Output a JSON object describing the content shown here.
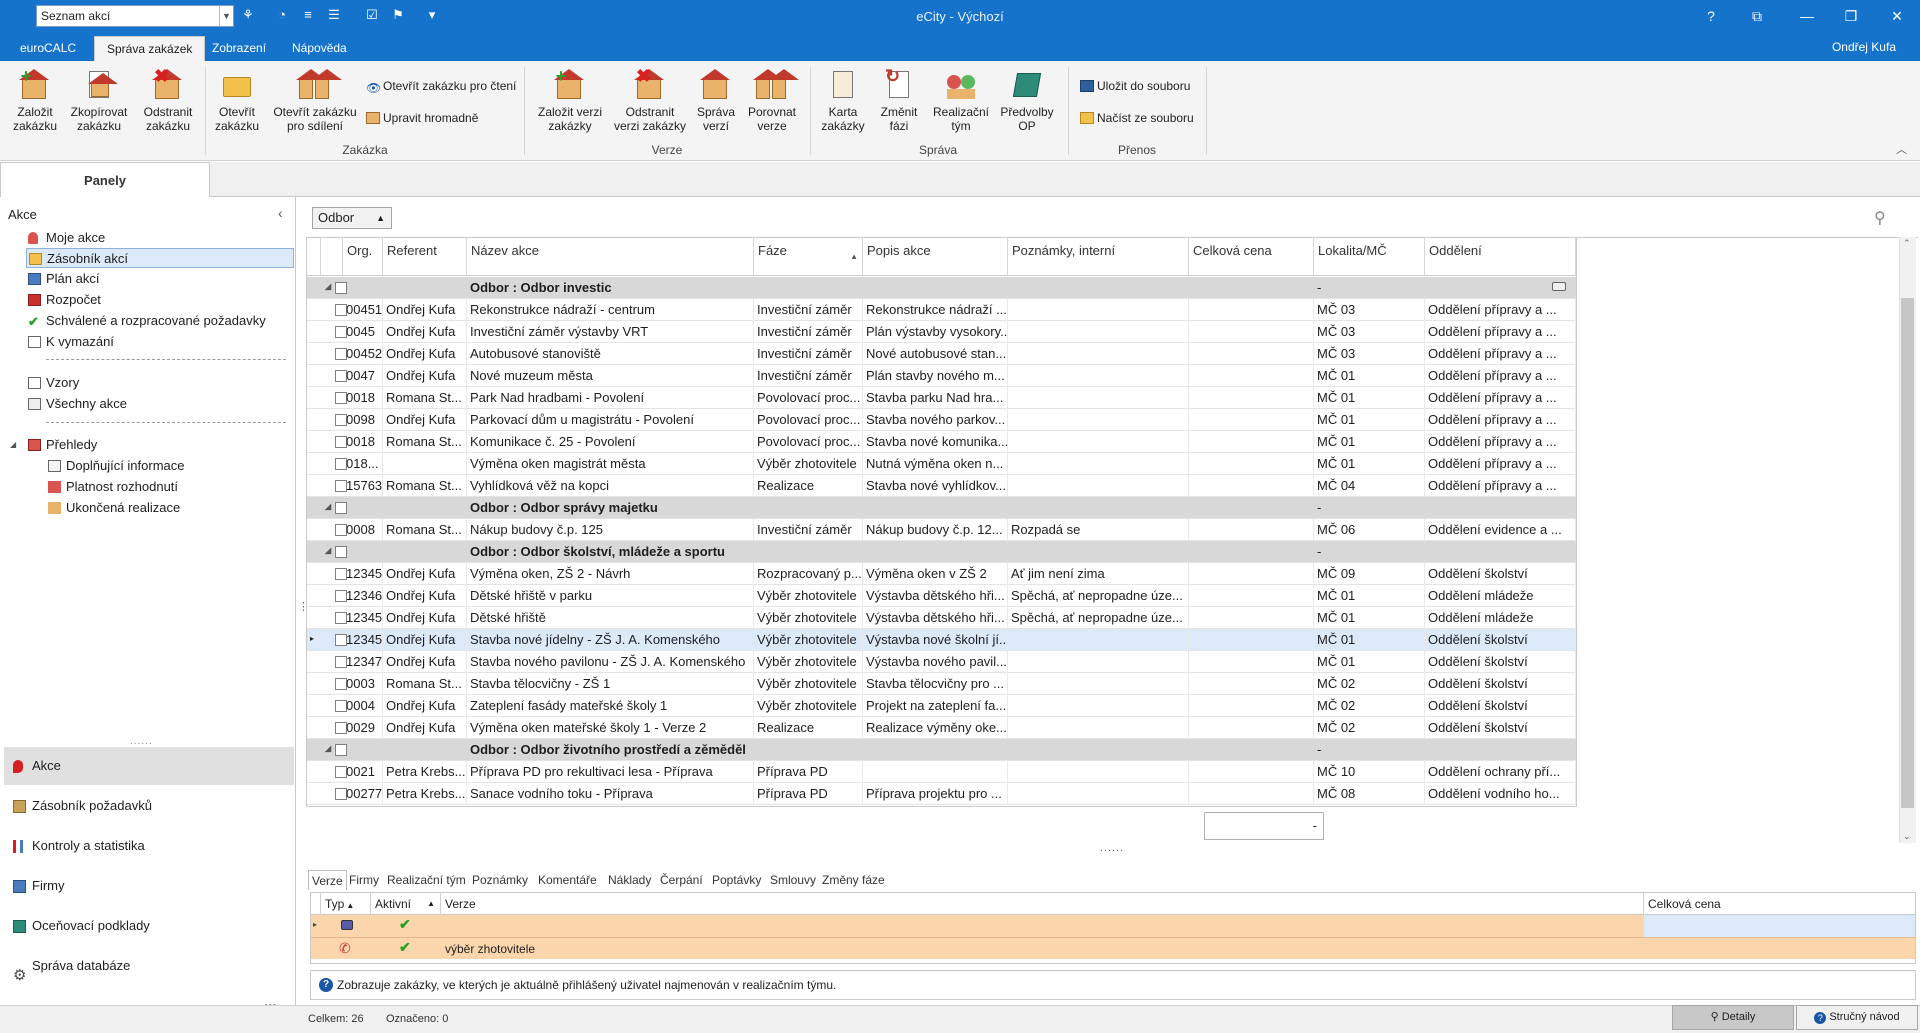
{
  "titlebar": {
    "combo_value": "Seznam akcí",
    "app_title": "eCity - Výchozí"
  },
  "menu": {
    "tabs": [
      "euroCALC",
      "Správa zakázek",
      "Zobrazení",
      "Nápověda"
    ],
    "active_tab": "Správa zakázek",
    "user": "Ondřej Kufa"
  },
  "ribbon": {
    "zakazka": {
      "group": "Zakázka",
      "zalozit": "Založit\nzakázku",
      "zkopirovat": "Zkopírovat\nzakázku",
      "odstranit": "Odstranit\nzakázku",
      "otevrit": "Otevřít\nzakázku",
      "otevrit_sdileni": "Otevřít zakázku\npro sdílení",
      "otevrit_cteni": "Otevřít zakázku pro čtení",
      "upravit_hromadne": "Upravit hromadně"
    },
    "verze": {
      "group": "Verze",
      "zalozit": "Založit verzi\nzakázky",
      "odstranit": "Odstranit\nverzi zakázky",
      "sprava": "Správa\nverzí",
      "porovnat": "Porovnat\nverze"
    },
    "sprava": {
      "group": "Správa",
      "karta": "Karta\nzakázky",
      "zmenit": "Změnit\nfázi",
      "tym": "Realizační\ntým",
      "predvolby": "Předvolby\nOP"
    },
    "prenos": {
      "group": "Přenos",
      "ulozit": "Uložit do souboru",
      "nacist": "Načíst ze souboru"
    }
  },
  "left": {
    "panel_tab": "Panely",
    "section": "Akce",
    "items": [
      {
        "label": "Moje akce",
        "icon": "person-icon"
      },
      {
        "label": "Zásobník akcí",
        "icon": "folder-icon"
      },
      {
        "label": "Plán akcí",
        "icon": "plan-icon"
      },
      {
        "label": "Rozpočet",
        "icon": "budget-icon"
      },
      {
        "label": "Schválené a rozpracované požadavky",
        "icon": "check-icon"
      },
      {
        "label": "K vymazání",
        "icon": "erase-icon"
      }
    ],
    "items2": [
      {
        "label": "Vzory",
        "icon": "template-icon"
      },
      {
        "label": "Všechny akce",
        "icon": "all-icon"
      }
    ],
    "overview": {
      "label": "Přehledy",
      "children": [
        "Doplňující informace",
        "Platnost rozhodnutí",
        "Ukončená realizace"
      ]
    },
    "nav": [
      "Akce",
      "Zásobník požadavků",
      "Kontroly a statistika",
      "Firmy",
      "Oceňovací podklady",
      "Správa databáze"
    ],
    "more": "•••"
  },
  "filter": {
    "chip": "Odbor"
  },
  "grid": {
    "columns": [
      "Org.",
      "Referent",
      "Název akce",
      "Fáze",
      "Popis akce",
      "Poznámky, interní",
      "Celková cena",
      "Lokalita/MČ",
      "Oddělení"
    ],
    "rows": [
      {
        "type": "group",
        "label": "Odbor : Odbor investic",
        "price": "-"
      },
      {
        "org": "00451",
        "ref": "Ondřej Kufa",
        "name": "Rekonstrukce nádraží - centrum",
        "faze": "Investiční záměr",
        "popis": "Rekonstrukce nádraží ...",
        "pozn": "",
        "cena": "",
        "lok": "MČ 03",
        "odd": "Oddělení přípravy a ..."
      },
      {
        "org": "0045",
        "ref": "Ondřej Kufa",
        "name": "Investiční záměr výstavby VRT",
        "faze": "Investiční záměr",
        "popis": "Plán výstavby vysokory...",
        "pozn": "",
        "cena": "",
        "lok": "MČ 03",
        "odd": "Oddělení přípravy a ..."
      },
      {
        "org": "00452",
        "ref": "Ondřej Kufa",
        "name": "Autobusové stanoviště",
        "faze": "Investiční záměr",
        "popis": "Nové autobusové stan...",
        "pozn": "",
        "cena": "",
        "lok": "MČ 03",
        "odd": "Oddělení přípravy a ..."
      },
      {
        "org": "0047",
        "ref": "Ondřej Kufa",
        "name": "Nové muzeum města",
        "faze": "Investiční záměr",
        "popis": "Plán stavby nového m...",
        "pozn": "",
        "cena": "",
        "lok": "MČ 01",
        "odd": "Oddělení přípravy a ..."
      },
      {
        "org": "0018",
        "ref": "Romana St...",
        "name": "Park Nad hradbami - Povolení",
        "faze": "Povolovací proc...",
        "popis": "Stavba parku Nad hra...",
        "pozn": "",
        "cena": "",
        "lok": "MČ 01",
        "odd": "Oddělení přípravy a ..."
      },
      {
        "org": "0098",
        "ref": "Ondřej Kufa",
        "name": "Parkovací dům u magistrátu - Povolení",
        "faze": "Povolovací proc...",
        "popis": "Stavba nového parkov...",
        "pozn": "",
        "cena": "",
        "lok": "MČ 01",
        "odd": "Oddělení přípravy a ..."
      },
      {
        "org": "0018",
        "ref": "Romana St...",
        "name": "Komunikace č. 25 - Povolení",
        "faze": "Povolovací proc...",
        "popis": "Stavba nové komunika...",
        "pozn": "",
        "cena": "",
        "lok": "MČ 01",
        "odd": "Oddělení přípravy a ..."
      },
      {
        "org": "018...",
        "ref": "",
        "name": "Výměna oken magistrát města",
        "faze": "Výběr zhotovitele",
        "popis": "Nutná výměna oken n...",
        "pozn": "",
        "cena": "",
        "lok": "MČ 01",
        "odd": "Oddělení přípravy a ..."
      },
      {
        "org": "15763",
        "ref": "Romana St...",
        "name": "Vyhlídková věž na kopci",
        "faze": "Realizace",
        "popis": "Stavba nové vyhlídkov...",
        "pozn": "",
        "cena": "",
        "lok": "MČ 04",
        "odd": "Oddělení přípravy a ..."
      },
      {
        "type": "group",
        "label": "Odbor : Odbor správy majetku",
        "price": "-"
      },
      {
        "org": "0008",
        "ref": "Romana St...",
        "name": "Nákup budovy č.p. 125",
        "faze": "Investiční záměr",
        "popis": "Nákup budovy č.p. 12...",
        "pozn": "Rozpadá se",
        "cena": "",
        "lok": "MČ 06",
        "odd": "Oddělení evidence a ..."
      },
      {
        "type": "group",
        "label": "Odbor : Odbor školství, mládeže a sportu",
        "price": "-"
      },
      {
        "org": "12345",
        "ref": "Ondřej Kufa",
        "name": "Výměna oken, ZŠ 2 - Návrh",
        "faze": "Rozpracovaný p...",
        "popis": "Výměna oken v ZŠ 2",
        "pozn": "Ať jim není zima",
        "cena": "",
        "lok": "MČ 09",
        "odd": "Oddělení školství"
      },
      {
        "org": "12346",
        "ref": "Ondřej Kufa",
        "name": "Dětské hřiště v parku",
        "faze": "Výběr zhotovitele",
        "popis": "Výstavba dětského hři...",
        "pozn": "Spěchá, ať nepropadne úze...",
        "cena": "",
        "lok": "MČ 01",
        "odd": "Oddělení mládeže"
      },
      {
        "org": "12345",
        "ref": "Ondřej Kufa",
        "name": "Dětské hřiště",
        "faze": "Výběr zhotovitele",
        "popis": "Výstavba dětského hři...",
        "pozn": "Spěchá, ať nepropadne úze...",
        "cena": "",
        "lok": "MČ 01",
        "odd": "Oddělení mládeže"
      },
      {
        "org": "12345",
        "ref": "Ondřej Kufa",
        "name": "Stavba nové jídelny - ZŠ J. A. Komenského",
        "faze": "Výběr zhotovitele",
        "popis": "Výstavba nové školní jí...",
        "pozn": "",
        "cena": "",
        "lok": "MČ 01",
        "odd": "Oddělení školství",
        "selected": true
      },
      {
        "org": "12347",
        "ref": "Ondřej Kufa",
        "name": "Stavba nového pavilonu - ZŠ J. A. Komenského",
        "faze": "Výběr zhotovitele",
        "popis": "Výstavba nového pavil...",
        "pozn": "",
        "cena": "",
        "lok": "MČ 01",
        "odd": "Oddělení školství"
      },
      {
        "org": "0003",
        "ref": "Romana St...",
        "name": "Stavba tělocvičny - ZŠ 1",
        "faze": "Výběr zhotovitele",
        "popis": "Stavba tělocvičny pro ...",
        "pozn": "",
        "cena": "",
        "lok": "MČ 02",
        "odd": "Oddělení školství"
      },
      {
        "org": "0004",
        "ref": "Ondřej Kufa",
        "name": "Zateplení fasády mateřské školy 1",
        "faze": "Výběr zhotovitele",
        "popis": "Projekt na zateplení fa...",
        "pozn": "",
        "cena": "",
        "lok": "MČ 02",
        "odd": "Oddělení školství"
      },
      {
        "org": "0029",
        "ref": "Ondřej Kufa",
        "name": "Výměna oken mateřské školy 1 - Verze 2",
        "faze": "Realizace",
        "popis": "Realizace výměny oke...",
        "pozn": "",
        "cena": "",
        "lok": "MČ 02",
        "odd": "Oddělení školství"
      },
      {
        "type": "group",
        "label": "Odbor : Odbor životního prostředí a zěměděl",
        "price": "-"
      },
      {
        "org": "0021",
        "ref": "Petra Krebs...",
        "name": "Příprava PD pro rekultivaci lesa - Příprava",
        "faze": "Příprava PD",
        "popis": "",
        "pozn": "",
        "cena": "",
        "lok": "MČ 10",
        "odd": "Oddělení ochrany pří..."
      },
      {
        "org": "00277",
        "ref": "Petra Krebs...",
        "name": "Sanace vodního toku - Příprava",
        "faze": "Příprava PD",
        "popis": "Příprava projektu pro ...",
        "pozn": "",
        "cena": "",
        "lok": "MČ 08",
        "odd": "Oddělení vodního ho..."
      }
    ],
    "summary": "-"
  },
  "detail": {
    "tabs": [
      "Verze",
      "Firmy",
      "Realizační tým",
      "Poznámky",
      "Komentáře",
      "Náklady",
      "Čerpání",
      "Poptávky",
      "Smlouvy",
      "Změny fáze"
    ],
    "columns": [
      "Typ",
      "Aktivní",
      "Verze",
      "Celková cena"
    ],
    "rows": [
      {
        "verze": "",
        "cena": ""
      },
      {
        "verze": "výběr zhotovitele",
        "cena": ""
      }
    ],
    "hint": "Zobrazuje zakázky, ve kterých je aktuálně přihlášený uživatel najmenován v realizačním týmu."
  },
  "status": {
    "celkem": "Celkem: 26",
    "oznaceno": "Označeno: 0",
    "detaily": "Detaily",
    "strucny": "Stručný návod"
  }
}
